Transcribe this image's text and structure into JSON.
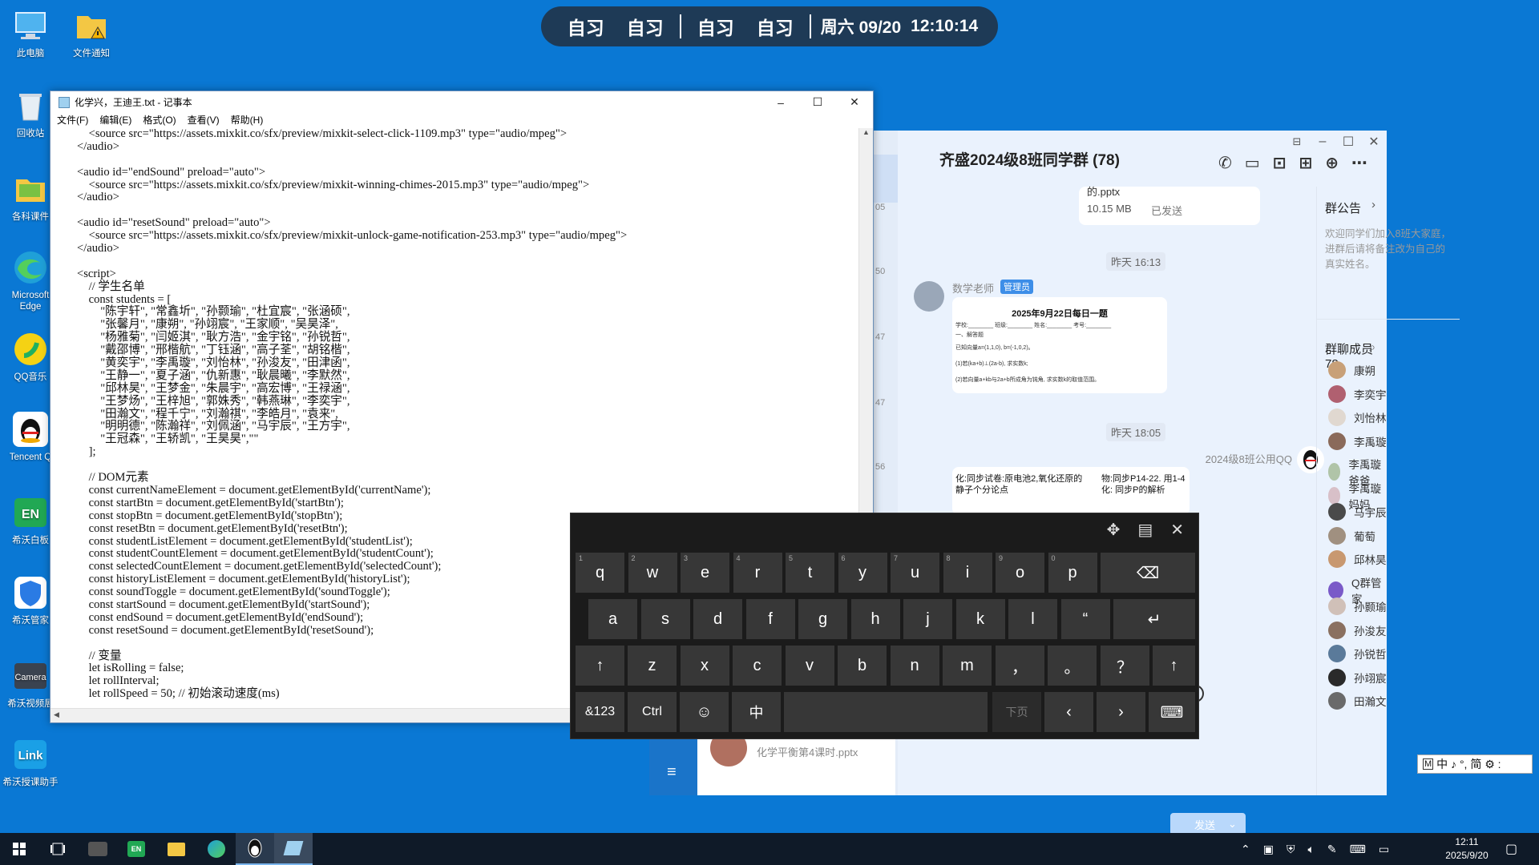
{
  "desktop_icons": [
    {
      "label": "此电脑",
      "icon": "computer-icon"
    },
    {
      "label": "文件通知",
      "icon": "folder-warning-icon"
    },
    {
      "label": "回收站",
      "icon": "recycle-bin-icon"
    },
    {
      "label": "各科课件",
      "icon": "folder-icon"
    },
    {
      "label": "Microsoft Edge",
      "icon": "edge-icon"
    },
    {
      "label": "QQ音乐",
      "icon": "qq-music-icon"
    },
    {
      "label": "Tencent Q",
      "icon": "qq-penguin-icon"
    },
    {
      "label": "希沃白板",
      "icon": "whiteboard-icon"
    },
    {
      "label": "希沃管家",
      "icon": "shield-icon"
    },
    {
      "label": "希沃视频展",
      "icon": "camera-icon"
    },
    {
      "label": "希沃授课助手",
      "icon": "link-icon"
    }
  ],
  "schedule_bar": {
    "items": [
      "自习",
      "自习",
      "自习",
      "自习"
    ],
    "date": "周六 09/20",
    "time": "12:10:14"
  },
  "notepad": {
    "title": "化学兴，王迪王.txt - 记事本",
    "menu": [
      "文件(F)",
      "编辑(E)",
      "格式(O)",
      "查看(V)",
      "帮助(H)"
    ],
    "lines": [
      "    <source src=\"https://assets.mixkit.co/sfx/preview/mixkit-select-click-1109.mp3\" type=\"audio/mpeg\">",
      "</audio>",
      "",
      "<audio id=\"endSound\" preload=\"auto\">",
      "    <source src=\"https://assets.mixkit.co/sfx/preview/mixkit-winning-chimes-2015.mp3\" type=\"audio/mpeg\">",
      "</audio>",
      "",
      "<audio id=\"resetSound\" preload=\"auto\">",
      "    <source src=\"https://assets.mixkit.co/sfx/preview/mixkit-unlock-game-notification-253.mp3\" type=\"audio/mpeg\">",
      "</audio>",
      "",
      "<script>",
      "    // 学生名单",
      "    const students = [",
      "        \"陈宇轩\", \"常鑫圻\", \"孙颢瑜\", \"杜宜宸\", \"张涵硕\",",
      "        \"张馨月\", \"康朔\", \"孙翊宸\", \"王家顺\", \"吴昊泽\",",
      "        \"杨雅菊\", \"闫姬淇\", \"耿方浩\", \"金宇铭\", \"孙锐哲\",",
      "        \"戴邵博\", \"邢楷航\", \"丁钰涵\", \"高子荃\", \"胡铭楷\",",
      "        \"黄奕宇\", \"李禹璇\", \"刘怡林\", \"孙浚友\", \"田津函\",",
      "        \"王静一\", \"夏子涵\", \"仇新惠\", \"耿晨曦\", \"李默然\",",
      "        \"邱林昊\", \"王梦金\", \"朱晨宇\", \"高宏博\", \"王禄涵\",",
      "        \"王梦炀\", \"王梓旭\", \"郭姝秀\", \"韩燕琳\", \"李奕宇\",",
      "        \"田瀚文\", \"程千宁\", \"刘瀚祺\", \"李皓月\", \"袁来\",",
      "        \"明明德\", \"陈瀚祥\", \"刘佩涵\", \"马宇辰\", \"王方宇\",",
      "        \"王冠森\", \"王轿凯\", \"王昊昊\",\"\"",
      "    ];",
      "",
      "    // DOM元素",
      "    const currentNameElement = document.getElementById('currentName');",
      "    const startBtn = document.getElementById('startBtn');",
      "    const stopBtn = document.getElementById('stopBtn');",
      "    const resetBtn = document.getElementById('resetBtn');",
      "    const studentListElement = document.getElementById('studentList');",
      "    const studentCountElement = document.getElementById('studentCount');",
      "    const selectedCountElement = document.getElementById('selectedCount');",
      "    const historyListElement = document.getElementById('historyList');",
      "    const soundToggle = document.getElementById('soundToggle');",
      "    const startSound = document.getElementById('startSound');",
      "    const endSound = document.getElementById('endSound');",
      "    const resetSound = document.getElementById('resetSound');",
      "",
      "    // 变量",
      "    let isRolling = false;",
      "    let rollInterval;",
      "    let rollSpeed = 50; // 初始滚动速度(ms)"
    ]
  },
  "qq": {
    "title": "齐盛2024级8班同学群 (78)",
    "file_top": {
      "name": "的.pptx",
      "size": "10.15 MB",
      "status": "已发送"
    },
    "time1": "昨天 16:13",
    "sender1": "数学老师",
    "badge": "管理员",
    "doc_title": "2025年9月22日每日一题",
    "doc_lines": [
      "学校:________ 班级:________ 姓名:________ 考号:________",
      "一、解答题",
      "已知向量a=(1,1,0), b=(-1,0,2)。",
      "(1)若(ka+b)⊥(2a-b), 求实数k;",
      "(2)若向量a+kb与2a+b所成角为钝角, 求实数k的取值范围。"
    ],
    "time2": "昨天 18:05",
    "sender2": "2024级8班公用QQ",
    "hw_left": "化:同步试卷:原电池2,氧化还原的\n静子个分论点",
    "hw_right": "物:同步P14-22. 用1-4\n化: 同步P的解析",
    "file_bottom": "化学平衡第4课时.pptx",
    "send": "发送",
    "announcement_title": "群公告",
    "announcement_text": "欢迎同学们加入8班大家庭，进群后请将备注改为自己的真实姓名。",
    "members_title": "群聊成员",
    "members_count": "78",
    "members": [
      "康朔",
      "李奕宇",
      "刘怡林",
      "李禹璇",
      "李禹璇爸爸",
      "李禹璇妈妈",
      "马宇辰",
      "葡萄",
      "邱林昊",
      "Q群管家",
      "孙颢瑜",
      "孙浚友",
      "孙锐哲",
      "孙翊宸",
      "田瀚文"
    ],
    "side_numbers": [
      "05",
      "50",
      "47",
      "47",
      "56"
    ]
  },
  "keyboard": {
    "row1": [
      [
        "1",
        "q"
      ],
      [
        "2",
        "w"
      ],
      [
        "3",
        "e"
      ],
      [
        "4",
        "r"
      ],
      [
        "5",
        "t"
      ],
      [
        "6",
        "y"
      ],
      [
        "7",
        "u"
      ],
      [
        "8",
        "i"
      ],
      [
        "9",
        "o"
      ],
      [
        "0",
        "p"
      ]
    ],
    "row2": [
      "a",
      "s",
      "d",
      "f",
      "g",
      "h",
      "j",
      "k",
      "l",
      "“"
    ],
    "row3": [
      "z",
      "x",
      "c",
      "v",
      "b",
      "n",
      "m",
      "，",
      "。",
      "？"
    ],
    "sym": "&123",
    "ctrl": "Ctrl",
    "lang": "中",
    "page": "下页"
  },
  "ime": {
    "text": "中 ♪ °, 简 ⚙ :"
  },
  "taskbar": {
    "time": "12:11",
    "date": "2025/9/20"
  }
}
